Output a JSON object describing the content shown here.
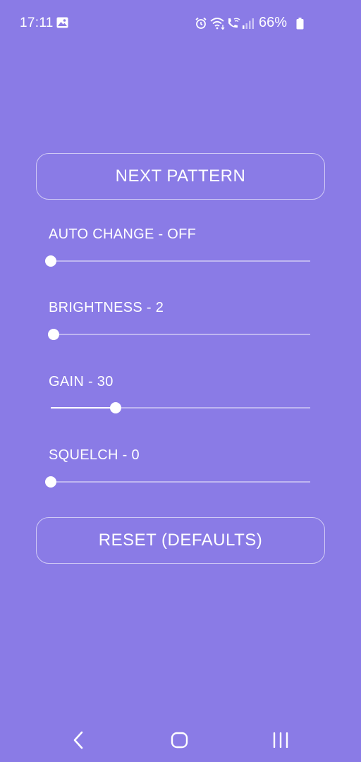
{
  "status_bar": {
    "time": "17:11",
    "battery_percent": "66%",
    "icons": [
      "gallery-icon",
      "alarm-icon",
      "wifi-icon",
      "wifi-calling-icon",
      "signal-icon",
      "battery-icon"
    ]
  },
  "controls": {
    "next_pattern_label": "NEXT PATTERN",
    "reset_label": "RESET (DEFAULTS)"
  },
  "sliders": [
    {
      "label": "AUTO CHANGE - OFF",
      "value": 0.0
    },
    {
      "label": "BRIGHTNESS - 2",
      "value": 0.01
    },
    {
      "label": "GAIN - 30",
      "value": 0.25
    },
    {
      "label": "SQUELCH - 0",
      "value": 0.0
    }
  ],
  "nav_bar": {
    "icons": [
      "back-icon",
      "home-icon",
      "recents-icon"
    ]
  },
  "colors": {
    "background": "#8a7be6",
    "foreground": "#ffffff"
  }
}
